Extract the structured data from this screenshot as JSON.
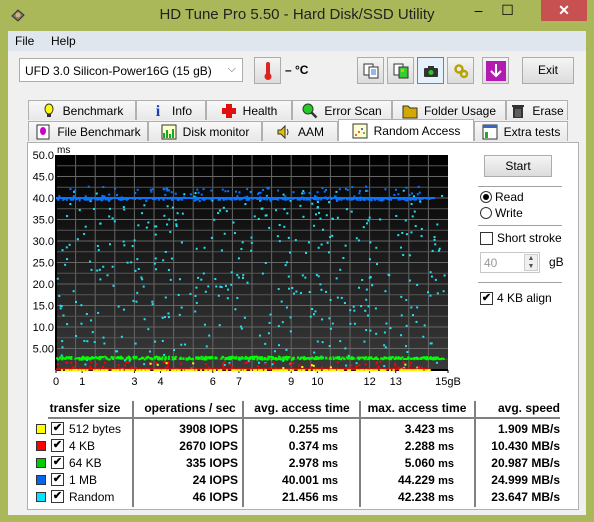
{
  "window": {
    "title": "HD Tune Pro 5.50 - Hard Disk/SSD Utility",
    "controls": {
      "minimize": "–",
      "maximize": "☐",
      "close": "✕"
    }
  },
  "menu": [
    "File",
    "Help"
  ],
  "toolbar": {
    "drive": "UFD 3.0 Silicon-Power16G (15 gB)",
    "temperature": "– °C",
    "exit_label": "Exit",
    "icons": [
      "thermometer-icon",
      "copy-text-icon",
      "copy-screenshot-icon",
      "camera-icon",
      "settings-icon",
      "save-down-icon"
    ]
  },
  "tabs": {
    "row1": [
      "Benchmark",
      "Info",
      "Health",
      "Error Scan",
      "Folder Usage",
      "Erase"
    ],
    "row2": [
      "File Benchmark",
      "Disk monitor",
      "AAM",
      "Random Access",
      "Extra tests"
    ],
    "selected": "Random Access"
  },
  "side": {
    "start_label": "Start",
    "read_label": "Read",
    "write_label": "Write",
    "mode": "Read",
    "short_stroke_label": "Short stroke",
    "short_stroke_checked": false,
    "short_stroke_value": "40",
    "short_stroke_unit": "gB",
    "align_label": "4 KB align",
    "align_checked": true
  },
  "results": {
    "headers": [
      "transfer size",
      "operations / sec",
      "avg. access time",
      "max. access time",
      "avg. speed"
    ],
    "rows": [
      {
        "label": "512 bytes",
        "color": "#ffff00",
        "checked": true,
        "iops": "3908",
        "avg": "0.255",
        "max": "3.423",
        "speed": "1.909 MB/s"
      },
      {
        "label": "4 KB",
        "color": "#ff0000",
        "checked": true,
        "iops": "2670",
        "avg": "0.374",
        "max": "2.288",
        "speed": "10.430 MB/s"
      },
      {
        "label": "64 KB",
        "color": "#00cc00",
        "checked": true,
        "iops": "335",
        "avg": "2.978",
        "max": "5.060",
        "speed": "20.987 MB/s"
      },
      {
        "label": "1 MB",
        "color": "#0066ee",
        "checked": true,
        "iops": "24",
        "avg": "40.001",
        "max": "44.229",
        "speed": "24.999 MB/s"
      },
      {
        "label": "Random",
        "color": "#00e5ff",
        "checked": true,
        "iops": "46",
        "avg": "21.456",
        "max": "42.238",
        "speed": "23.647 MB/s"
      }
    ],
    "iops_unit": "IOPS",
    "ms_unit": "ms"
  },
  "chart_data": {
    "type": "scatter",
    "ylabel": "ms",
    "xlabel": "",
    "ylim": [
      0,
      50
    ],
    "xlim": [
      0,
      15
    ],
    "y_ticks": [
      "50.0",
      "45.0",
      "40.0",
      "35.0",
      "30.0",
      "25.0",
      "20.0",
      "15.0",
      "10.0",
      "5.00"
    ],
    "x_ticks": [
      "0",
      "1",
      "3",
      "4",
      "6",
      "7",
      "9",
      "10",
      "12",
      "13",
      "15gB"
    ],
    "grid": true,
    "series": [
      {
        "name": "512 bytes",
        "color": "#ffff00",
        "mean_ms": 0.255,
        "max_ms": 3.423
      },
      {
        "name": "4 KB",
        "color": "#ff0000",
        "mean_ms": 0.374,
        "max_ms": 2.288
      },
      {
        "name": "64 KB",
        "color": "#00ff00",
        "mean_ms": 2.978,
        "max_ms": 5.06
      },
      {
        "name": "1 MB",
        "color": "#0a74ff",
        "mean_ms": 40.001,
        "max_ms": 44.229
      },
      {
        "name": "Random",
        "color": "#22e0f0",
        "mean_ms": 21.456,
        "max_ms": 42.238
      }
    ]
  }
}
